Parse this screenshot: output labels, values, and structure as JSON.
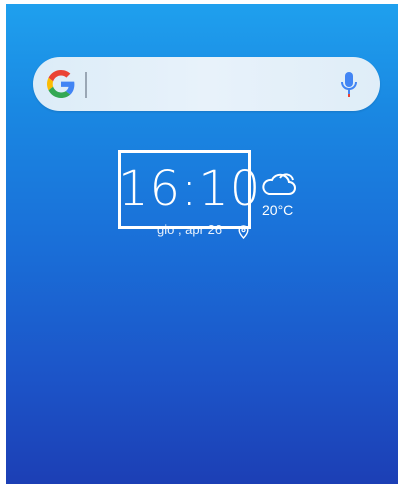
{
  "search": {
    "logo": "google-g-logo",
    "placeholder": "",
    "mic": "mic-icon"
  },
  "clock": {
    "time": "16:10",
    "date": "gio , apr 26"
  },
  "weather": {
    "icon": "cloud-icon",
    "temperature": "20°C"
  },
  "colors": {
    "wallpaper_top": "#1fa0ee",
    "wallpaper_bottom": "#1c3fb5",
    "search_bar": "#e4eff9",
    "text": "#ffffff"
  }
}
